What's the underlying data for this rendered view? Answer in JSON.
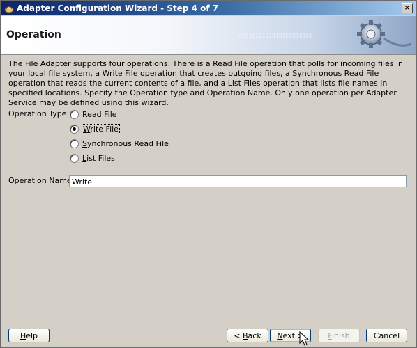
{
  "window": {
    "title": "Adapter Configuration Wizard - Step 4 of 7",
    "close_label": "×"
  },
  "header": {
    "title": "Operation",
    "binary_text": "0101010101010101010101"
  },
  "description": "The File Adapter supports four operations.  There is a Read File operation that polls for incoming files in your local file system, a Write File operation that creates outgoing files, a Synchronous Read File operation that reads the current contents of a file, and a List Files operation that lists file names in specified locations.  Specify the Operation type and Operation Name.  Only one operation per Adapter Service may be defined using this wizard.",
  "operation_type": {
    "label": "Operation Type:",
    "options": [
      {
        "label": "Read File",
        "mnemonic": "R",
        "rest": "ead File",
        "selected": false
      },
      {
        "label": "Write File",
        "mnemonic": "W",
        "rest": "rite File",
        "selected": true
      },
      {
        "label": "Synchronous Read File",
        "mnemonic": "S",
        "rest": "ynchronous Read File",
        "selected": false
      },
      {
        "label": "List Files",
        "mnemonic": "L",
        "rest": "ist Files",
        "selected": false
      }
    ]
  },
  "operation_name": {
    "label_mnemonic": "O",
    "label_rest": "peration Name:",
    "value": "Write"
  },
  "buttons": {
    "help_mnemonic": "H",
    "help_rest": "elp",
    "back_prefix": "< ",
    "back_mnemonic": "B",
    "back_rest": "ack",
    "next_mnemonic": "N",
    "next_rest": "ext >",
    "finish_mnemonic": "F",
    "finish_rest": "inish",
    "cancel": "Cancel"
  },
  "colors": {
    "titlebar_start": "#0a246a",
    "titlebar_end": "#a6caf0",
    "dialog_bg": "#d4d0c8"
  }
}
